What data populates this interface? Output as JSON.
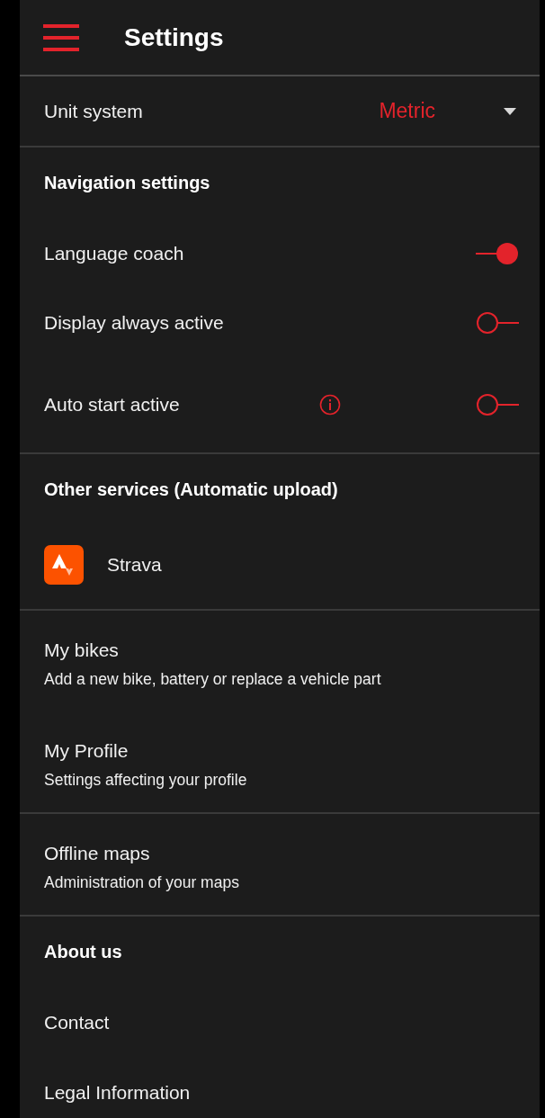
{
  "header": {
    "title": "Settings"
  },
  "sections": [
    {
      "items": [
        {
          "kind": "select",
          "label": "Unit system",
          "value": "Metric"
        }
      ]
    },
    {
      "items": [
        {
          "kind": "heading",
          "label": "Navigation settings"
        },
        {
          "kind": "toggle",
          "label": "Language coach",
          "on": true,
          "info": false
        },
        {
          "kind": "toggle",
          "label": "Display always active",
          "on": false,
          "info": false
        },
        {
          "kind": "toggle",
          "label": "Auto start active",
          "on": false,
          "info": true
        }
      ]
    },
    {
      "items": [
        {
          "kind": "heading",
          "label": "Other services (Automatic upload)"
        },
        {
          "kind": "service",
          "label": "Strava"
        }
      ]
    },
    {
      "items": [
        {
          "kind": "link",
          "label": "My bikes",
          "subtitle": "Add a new bike, battery or replace a vehicle part"
        },
        {
          "kind": "link",
          "label": "My Profile",
          "subtitle": "Settings affecting your profile"
        }
      ]
    },
    {
      "items": [
        {
          "kind": "link",
          "label": "Offline maps",
          "subtitle": "Administration of your maps"
        }
      ]
    },
    {
      "items": [
        {
          "kind": "heading",
          "label": "About us"
        },
        {
          "kind": "link",
          "label": "Contact"
        },
        {
          "kind": "link",
          "label": "Legal Information"
        }
      ]
    }
  ]
}
